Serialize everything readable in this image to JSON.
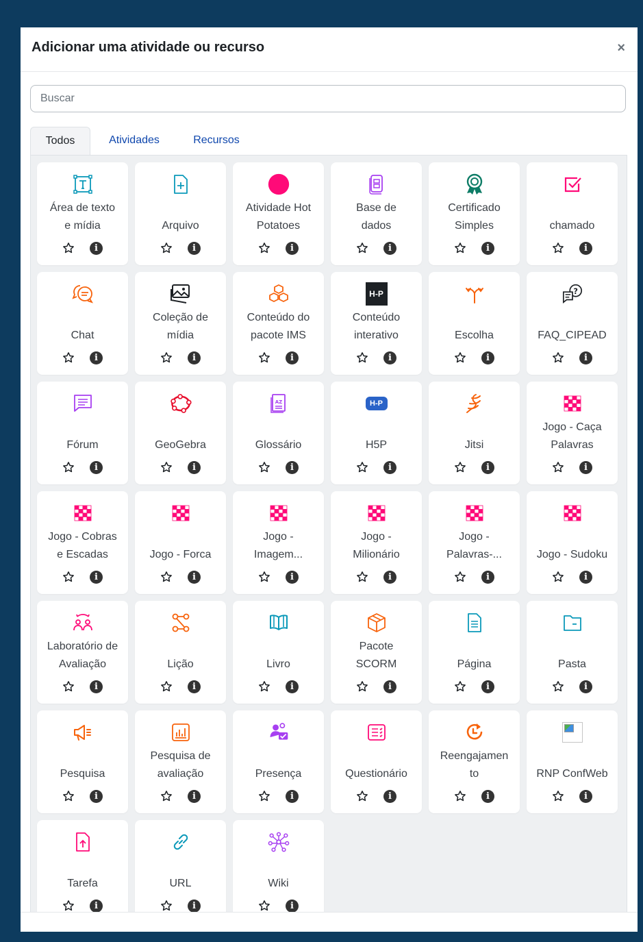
{
  "modal": {
    "title": "Adicionar uma atividade ou recurso",
    "close_label": "×"
  },
  "search": {
    "placeholder": "Buscar"
  },
  "tabs": [
    {
      "label": "Todos",
      "active": true
    },
    {
      "label": "Atividades",
      "active": false
    },
    {
      "label": "Recursos",
      "active": false
    }
  ],
  "colors": {
    "background_frame": "#0d3b5e",
    "link_blue": "#0f47ad",
    "pink": "#ff0a78",
    "orange": "#f7630c",
    "purple": "#a73ff1",
    "teal": "#0b99b9",
    "dark": "#1d2125"
  },
  "info_glyph": "i",
  "items": [
    {
      "name": "Área de texto\ne mídia",
      "icon": "text-area-icon"
    },
    {
      "name": "Arquivo",
      "icon": "file-icon"
    },
    {
      "name": "Atividade Hot\nPotatoes",
      "icon": "pink-circle-icon"
    },
    {
      "name": "Base de\ndados",
      "icon": "database-icon"
    },
    {
      "name": "Certificado\nSimples",
      "icon": "certificate-icon"
    },
    {
      "name": "chamado",
      "icon": "checkbox-icon"
    },
    {
      "name": "Chat",
      "icon": "chat-icon"
    },
    {
      "name": "Coleção de\nmídia",
      "icon": "media-collection-icon"
    },
    {
      "name": "Conteúdo do\npacote IMS",
      "icon": "ims-package-icon"
    },
    {
      "name": "Conteúdo\ninterativo",
      "icon": "h5p-dark-icon",
      "icon_text": "H-P"
    },
    {
      "name": "Escolha",
      "icon": "choice-icon"
    },
    {
      "name": "FAQ_CIPEAD",
      "icon": "faq-icon"
    },
    {
      "name": "Fórum",
      "icon": "forum-icon"
    },
    {
      "name": "GeoGebra",
      "icon": "geogebra-icon"
    },
    {
      "name": "Glossário",
      "icon": "glossary-icon",
      "icon_text": "AZ"
    },
    {
      "name": "H5P",
      "icon": "h5p-blue-icon",
      "icon_text": "H-P"
    },
    {
      "name": "Jitsi",
      "icon": "jitsi-icon"
    },
    {
      "name": "Jogo - Caça\nPalavras",
      "icon": "game-grid-icon"
    },
    {
      "name": "Jogo - Cobras\ne Escadas",
      "icon": "game-grid-icon"
    },
    {
      "name": "Jogo - Forca",
      "icon": "game-grid-icon"
    },
    {
      "name": "Jogo -\nImagem...",
      "icon": "game-grid-icon"
    },
    {
      "name": "Jogo -\nMilionário",
      "icon": "game-grid-icon"
    },
    {
      "name": "Jogo -\nPalavras-...",
      "icon": "game-grid-icon"
    },
    {
      "name": "Jogo - Sudoku",
      "icon": "game-grid-icon"
    },
    {
      "name": "Laboratório de\nAvaliação",
      "icon": "workshop-icon"
    },
    {
      "name": "Lição",
      "icon": "lesson-icon"
    },
    {
      "name": "Livro",
      "icon": "book-icon"
    },
    {
      "name": "Pacote\nSCORM",
      "icon": "scorm-package-icon"
    },
    {
      "name": "Página",
      "icon": "page-icon"
    },
    {
      "name": "Pasta",
      "icon": "folder-icon"
    },
    {
      "name": "Pesquisa",
      "icon": "megaphone-icon"
    },
    {
      "name": "Pesquisa de\navaliação",
      "icon": "feedback-chart-icon"
    },
    {
      "name": "Presença",
      "icon": "attendance-icon"
    },
    {
      "name": "Questionário",
      "icon": "quiz-icon"
    },
    {
      "name": "Reengajamen\nto",
      "icon": "reengagement-icon"
    },
    {
      "name": "RNP ConfWeb",
      "icon": "broken-image-icon"
    },
    {
      "name": "Tarefa",
      "icon": "assignment-icon"
    },
    {
      "name": "URL",
      "icon": "link-icon"
    },
    {
      "name": "Wiki",
      "icon": "wiki-icon"
    }
  ]
}
